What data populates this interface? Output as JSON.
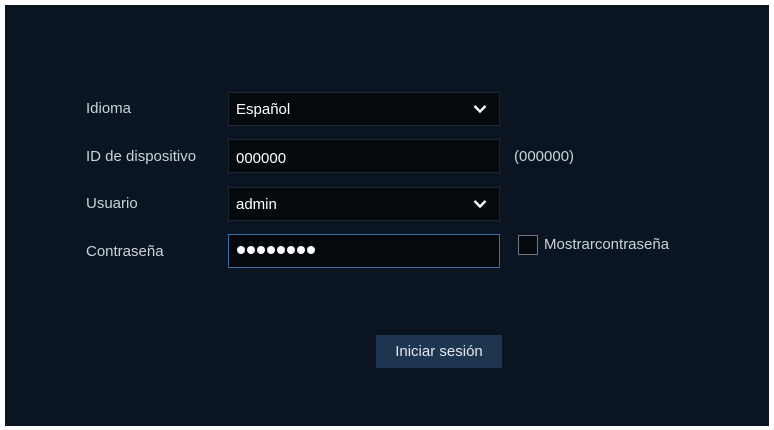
{
  "form": {
    "language": {
      "label": "Idioma",
      "value": "Español",
      "icon": "chevron-down-icon"
    },
    "device_id": {
      "label": "ID de dispositivo",
      "value": "000000",
      "hint": "(000000)"
    },
    "user": {
      "label": "Usuario",
      "value": "admin",
      "icon": "chevron-down-icon"
    },
    "password": {
      "label": "Contraseña",
      "masked_length": 8,
      "show_password_label": "Mostrarcontraseña",
      "show_password_checked": false
    },
    "login_button_label": "Iniciar sesión"
  },
  "colors": {
    "background": "#0b1522",
    "field_background": "#05080d",
    "focus_border": "#3b6fa8",
    "button_background": "#1e3550",
    "label_text": "#c9d2dc"
  }
}
